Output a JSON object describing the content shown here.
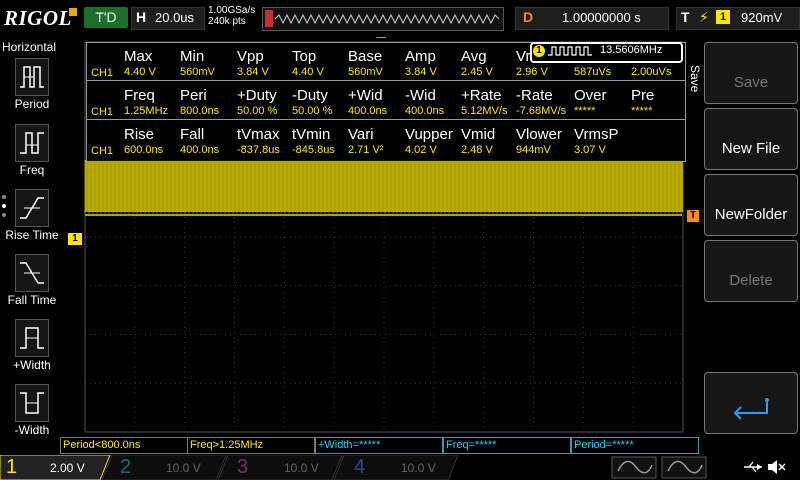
{
  "header": {
    "logo": "RIGOL",
    "run_status": "T'D",
    "h_label": "H",
    "timebase": "20.0us",
    "sample_rate": "1.00GSa/s",
    "memory_depth": "240k pts",
    "d_label": "D",
    "delay": "1.00000000 s",
    "t_label": "T",
    "trigger_source": "1",
    "trigger_level": "920mV"
  },
  "left_menu": {
    "title": "Horizontal",
    "items": [
      {
        "label": "Period"
      },
      {
        "label": "Freq"
      },
      {
        "label": "Rise Time"
      },
      {
        "label": "Fall Time"
      },
      {
        "label": "+Width"
      },
      {
        "label": "-Width"
      }
    ]
  },
  "measurements": {
    "row1_headers": [
      "Max",
      "Min",
      "Vpp",
      "Top",
      "Base",
      "Amp",
      "Avg",
      "Vr"
    ],
    "row1_values": [
      "4.40 V",
      "560mV",
      "3.84 V",
      "4.40 V",
      "560mV",
      "3.84 V",
      "2.45 V",
      "2.96 V",
      "587uVs",
      "2.00uVs"
    ],
    "row2_headers": [
      "Freq",
      "Peri",
      "+Duty",
      "-Duty",
      "+Wid",
      "-Wid",
      "+Rate",
      "-Rate",
      "Over",
      "Pre"
    ],
    "row2_values": [
      "1.25MHz",
      "800.0ns",
      "50.00 %",
      "50.00 %",
      "400.0ns",
      "400.0ns",
      "5.12MV/s",
      "-7.68MV/s",
      "*****",
      "*****"
    ],
    "row3_headers": [
      "Rise",
      "Fall",
      "tVmax",
      "tVmin",
      "Vari",
      "Vupper",
      "Vmid",
      "Vlower",
      "VrmsP"
    ],
    "row3_values": [
      "600.0ns",
      "400.0ns",
      "-837.8us",
      "-845.8us",
      "2.71 V²",
      "4.02 V",
      "2.48 V",
      "944mV",
      "3.07 V"
    ],
    "channel_label": "CH1",
    "freq_counter_channel": "1",
    "freq_counter_value": "13.5606MHz"
  },
  "markers": {
    "ch1": "1",
    "trigger": "T"
  },
  "right_menu": {
    "title": "Save",
    "buttons": [
      {
        "label": "Save",
        "enabled": false
      },
      {
        "label": "New File",
        "enabled": true
      },
      {
        "label": "NewFolder",
        "enabled": true
      },
      {
        "label": "Delete",
        "enabled": false
      },
      {
        "label": "enter-icon",
        "enabled": true
      }
    ]
  },
  "measure_bar": [
    {
      "text": "Period<800.0ns",
      "color": "#ffe600"
    },
    {
      "text": "Freq>1.25MHz",
      "color": "#ffe600"
    },
    {
      "text": "+Width=*****",
      "color": "#19d0ff"
    },
    {
      "text": "Freq=*****",
      "color": "#19d0ff"
    },
    {
      "text": "Period=*****",
      "color": "#19d0ff"
    }
  ],
  "channels": [
    {
      "num": "1",
      "scale": "2.00 V",
      "color": "#ffe600",
      "active": true
    },
    {
      "num": "2",
      "scale": "10.0 V",
      "color": "#19d0ff",
      "active": false
    },
    {
      "num": "3",
      "scale": "10.0 V",
      "color": "#ff44ff",
      "active": false
    },
    {
      "num": "4",
      "scale": "10.0 V",
      "color": "#2a7bff",
      "active": false
    }
  ],
  "colors": {
    "ch1": "#ffe600",
    "waveform": "#b0a000",
    "trigger": "#ff8a1a",
    "run_green": "#1b6f2b"
  }
}
